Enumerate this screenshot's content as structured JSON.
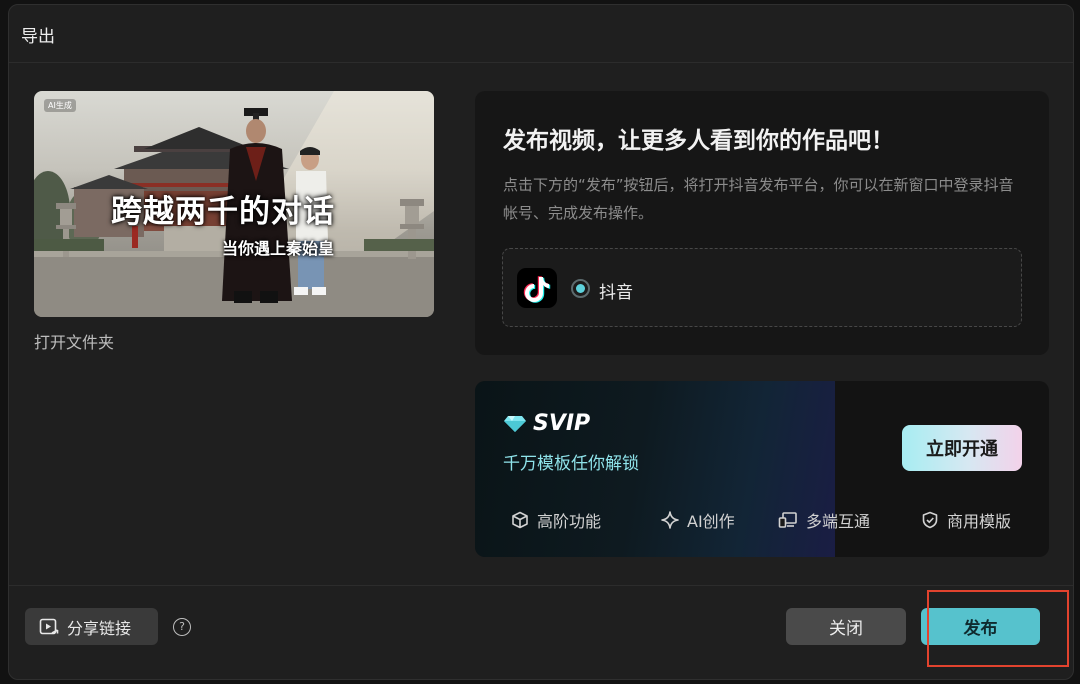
{
  "dialog": {
    "title": "导出"
  },
  "preview": {
    "ai_tag": "AI生成",
    "title": "跨越两千的对话",
    "subtitle": "当你遇上秦始皇",
    "open_folder": "打开文件夹"
  },
  "publish": {
    "heading": "发布视频，让更多人看到你的作品吧！",
    "description": "点击下方的“发布”按钮后，将打开抖音发布平台，你可以在新窗口中登录抖音帐号、完成发布操作。",
    "platform": {
      "name": "抖音",
      "icon": "tiktok-icon",
      "selected": true
    }
  },
  "svip": {
    "badge": "SVIP",
    "tagline": "千万模板任你解锁",
    "cta": "立即开通",
    "features": [
      {
        "label": "高阶功能",
        "icon": "cube-icon"
      },
      {
        "label": "AI创作",
        "icon": "sparkle-icon"
      },
      {
        "label": "多端互通",
        "icon": "devices-icon"
      },
      {
        "label": "商用模版",
        "icon": "shield-check-icon"
      }
    ]
  },
  "footer": {
    "share_label": "分享链接",
    "help_symbol": "?",
    "close_label": "关闭",
    "publish_label": "发布"
  },
  "colors": {
    "accent": "#56c2cd",
    "highlight": "#e2432e",
    "svip_text": "#8fe3ea"
  }
}
